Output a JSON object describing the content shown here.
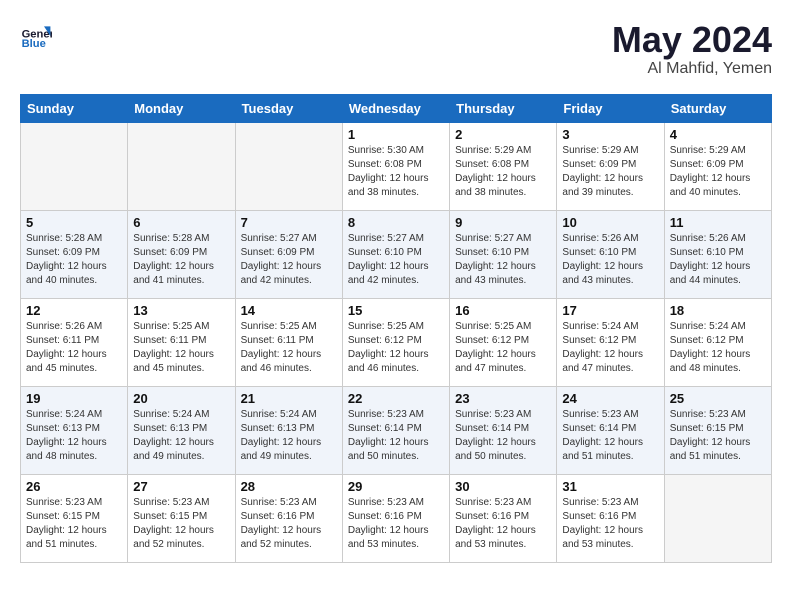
{
  "header": {
    "logo_line1": "General",
    "logo_line2": "Blue",
    "month_year": "May 2024",
    "location": "Al Mahfid, Yemen"
  },
  "weekdays": [
    "Sunday",
    "Monday",
    "Tuesday",
    "Wednesday",
    "Thursday",
    "Friday",
    "Saturday"
  ],
  "weeks": [
    [
      {
        "day": "",
        "info": ""
      },
      {
        "day": "",
        "info": ""
      },
      {
        "day": "",
        "info": ""
      },
      {
        "day": "1",
        "info": "Sunrise: 5:30 AM\nSunset: 6:08 PM\nDaylight: 12 hours\nand 38 minutes."
      },
      {
        "day": "2",
        "info": "Sunrise: 5:29 AM\nSunset: 6:08 PM\nDaylight: 12 hours\nand 38 minutes."
      },
      {
        "day": "3",
        "info": "Sunrise: 5:29 AM\nSunset: 6:09 PM\nDaylight: 12 hours\nand 39 minutes."
      },
      {
        "day": "4",
        "info": "Sunrise: 5:29 AM\nSunset: 6:09 PM\nDaylight: 12 hours\nand 40 minutes."
      }
    ],
    [
      {
        "day": "5",
        "info": "Sunrise: 5:28 AM\nSunset: 6:09 PM\nDaylight: 12 hours\nand 40 minutes."
      },
      {
        "day": "6",
        "info": "Sunrise: 5:28 AM\nSunset: 6:09 PM\nDaylight: 12 hours\nand 41 minutes."
      },
      {
        "day": "7",
        "info": "Sunrise: 5:27 AM\nSunset: 6:09 PM\nDaylight: 12 hours\nand 42 minutes."
      },
      {
        "day": "8",
        "info": "Sunrise: 5:27 AM\nSunset: 6:10 PM\nDaylight: 12 hours\nand 42 minutes."
      },
      {
        "day": "9",
        "info": "Sunrise: 5:27 AM\nSunset: 6:10 PM\nDaylight: 12 hours\nand 43 minutes."
      },
      {
        "day": "10",
        "info": "Sunrise: 5:26 AM\nSunset: 6:10 PM\nDaylight: 12 hours\nand 43 minutes."
      },
      {
        "day": "11",
        "info": "Sunrise: 5:26 AM\nSunset: 6:10 PM\nDaylight: 12 hours\nand 44 minutes."
      }
    ],
    [
      {
        "day": "12",
        "info": "Sunrise: 5:26 AM\nSunset: 6:11 PM\nDaylight: 12 hours\nand 45 minutes."
      },
      {
        "day": "13",
        "info": "Sunrise: 5:25 AM\nSunset: 6:11 PM\nDaylight: 12 hours\nand 45 minutes."
      },
      {
        "day": "14",
        "info": "Sunrise: 5:25 AM\nSunset: 6:11 PM\nDaylight: 12 hours\nand 46 minutes."
      },
      {
        "day": "15",
        "info": "Sunrise: 5:25 AM\nSunset: 6:12 PM\nDaylight: 12 hours\nand 46 minutes."
      },
      {
        "day": "16",
        "info": "Sunrise: 5:25 AM\nSunset: 6:12 PM\nDaylight: 12 hours\nand 47 minutes."
      },
      {
        "day": "17",
        "info": "Sunrise: 5:24 AM\nSunset: 6:12 PM\nDaylight: 12 hours\nand 47 minutes."
      },
      {
        "day": "18",
        "info": "Sunrise: 5:24 AM\nSunset: 6:12 PM\nDaylight: 12 hours\nand 48 minutes."
      }
    ],
    [
      {
        "day": "19",
        "info": "Sunrise: 5:24 AM\nSunset: 6:13 PM\nDaylight: 12 hours\nand 48 minutes."
      },
      {
        "day": "20",
        "info": "Sunrise: 5:24 AM\nSunset: 6:13 PM\nDaylight: 12 hours\nand 49 minutes."
      },
      {
        "day": "21",
        "info": "Sunrise: 5:24 AM\nSunset: 6:13 PM\nDaylight: 12 hours\nand 49 minutes."
      },
      {
        "day": "22",
        "info": "Sunrise: 5:23 AM\nSunset: 6:14 PM\nDaylight: 12 hours\nand 50 minutes."
      },
      {
        "day": "23",
        "info": "Sunrise: 5:23 AM\nSunset: 6:14 PM\nDaylight: 12 hours\nand 50 minutes."
      },
      {
        "day": "24",
        "info": "Sunrise: 5:23 AM\nSunset: 6:14 PM\nDaylight: 12 hours\nand 51 minutes."
      },
      {
        "day": "25",
        "info": "Sunrise: 5:23 AM\nSunset: 6:15 PM\nDaylight: 12 hours\nand 51 minutes."
      }
    ],
    [
      {
        "day": "26",
        "info": "Sunrise: 5:23 AM\nSunset: 6:15 PM\nDaylight: 12 hours\nand 51 minutes."
      },
      {
        "day": "27",
        "info": "Sunrise: 5:23 AM\nSunset: 6:15 PM\nDaylight: 12 hours\nand 52 minutes."
      },
      {
        "day": "28",
        "info": "Sunrise: 5:23 AM\nSunset: 6:16 PM\nDaylight: 12 hours\nand 52 minutes."
      },
      {
        "day": "29",
        "info": "Sunrise: 5:23 AM\nSunset: 6:16 PM\nDaylight: 12 hours\nand 53 minutes."
      },
      {
        "day": "30",
        "info": "Sunrise: 5:23 AM\nSunset: 6:16 PM\nDaylight: 12 hours\nand 53 minutes."
      },
      {
        "day": "31",
        "info": "Sunrise: 5:23 AM\nSunset: 6:16 PM\nDaylight: 12 hours\nand 53 minutes."
      },
      {
        "day": "",
        "info": ""
      }
    ]
  ]
}
